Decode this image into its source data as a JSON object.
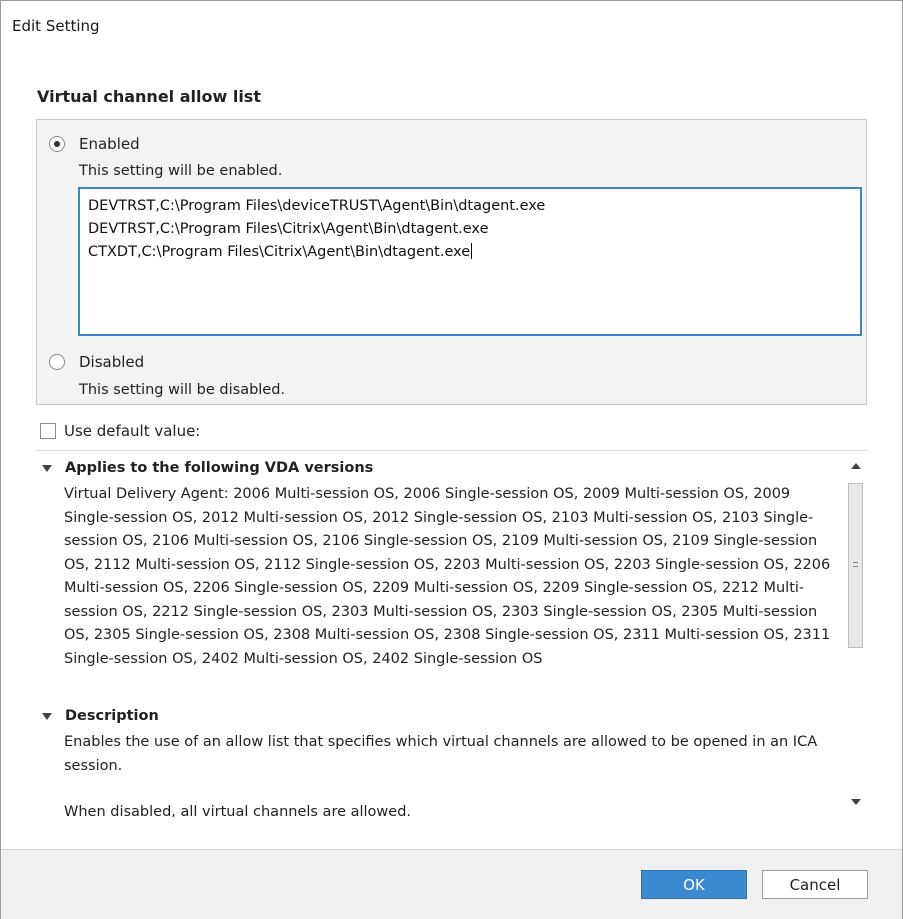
{
  "window": {
    "title": "Edit Setting"
  },
  "setting": {
    "name": "Virtual channel allow list"
  },
  "options": {
    "enabled_label": "Enabled",
    "enabled_hint": "This setting will be enabled.",
    "disabled_label": "Disabled",
    "disabled_hint": "This setting will be disabled.",
    "selected": "Enabled"
  },
  "allow_list": {
    "lines": [
      "DEVTRST,C:\\Program Files\\deviceTRUST\\Agent\\Bin\\dtagent.exe",
      "DEVTRST,C:\\Program Files\\Citrix\\Agent\\Bin\\dtagent.exe",
      "CTXDT,C:\\Program Files\\Citrix\\Agent\\Bin\\dtagent.exe"
    ]
  },
  "use_default": {
    "label": "Use default value:",
    "checked": false
  },
  "info": {
    "applies_heading": "Applies to the following VDA versions",
    "applies_text": "Virtual Delivery Agent: 2006 Multi-session OS, 2006 Single-session OS, 2009 Multi-session OS, 2009 Single-session OS, 2012 Multi-session OS, 2012 Single-session OS, 2103 Multi-session OS, 2103 Single-session OS, 2106 Multi-session OS, 2106 Single-session OS, 2109 Multi-session OS, 2109 Single-session OS, 2112 Multi-session OS, 2112 Single-session OS, 2203 Multi-session OS, 2203 Single-session OS, 2206 Multi-session OS, 2206 Single-session OS, 2209 Multi-session OS, 2209 Single-session OS, 2212 Multi-session OS, 2212 Single-session OS, 2303 Multi-session OS, 2303 Single-session OS, 2305 Multi-session OS, 2305 Single-session OS, 2308 Multi-session OS, 2308 Single-session OS, 2311 Multi-session OS, 2311 Single-session OS, 2402 Multi-session OS, 2402 Single-session OS",
    "description_heading": "Description",
    "description_text": "Enables the use of an allow list that specifies which virtual channels are allowed to be opened in an ICA session.",
    "description_text_2": "When disabled, all virtual channels are allowed."
  },
  "buttons": {
    "ok": "OK",
    "cancel": "Cancel"
  }
}
